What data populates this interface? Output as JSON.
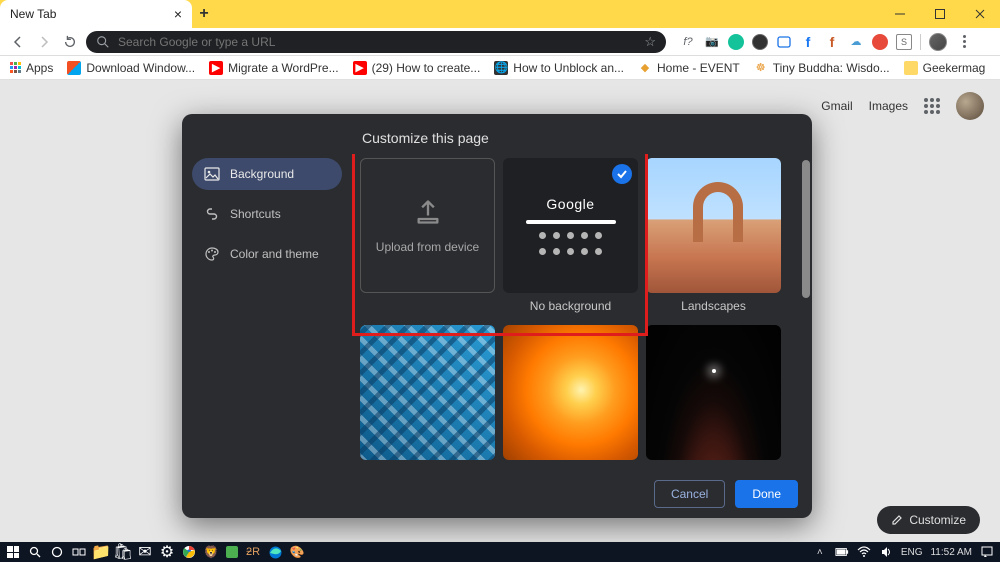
{
  "tab": {
    "title": "New Tab"
  },
  "omnibox": {
    "placeholder": "Search Google or type a URL"
  },
  "toolbar_icons": {
    "f_question": "f?"
  },
  "bookmarks": {
    "apps": "Apps",
    "items": [
      {
        "label": "Download Window..."
      },
      {
        "label": "Migrate a WordPre..."
      },
      {
        "label": "(29) How to create..."
      },
      {
        "label": "How to Unblock an..."
      },
      {
        "label": "Home - EVENT"
      },
      {
        "label": "Tiny Buddha: Wisdo..."
      },
      {
        "label": "Geekermag"
      }
    ]
  },
  "top_links": {
    "gmail": "Gmail",
    "images": "Images"
  },
  "dialog": {
    "title": "Customize this page",
    "sidebar": {
      "background": "Background",
      "shortcuts": "Shortcuts",
      "color_theme": "Color and theme"
    },
    "upload_label": "Upload from device",
    "no_background_label": "No background",
    "landscapes_label": "Landscapes",
    "google_logo": "Google",
    "cancel": "Cancel",
    "done": "Done"
  },
  "customize_button": "Customize",
  "tray": {
    "lang": "ENG",
    "time": "11:52 AM"
  }
}
